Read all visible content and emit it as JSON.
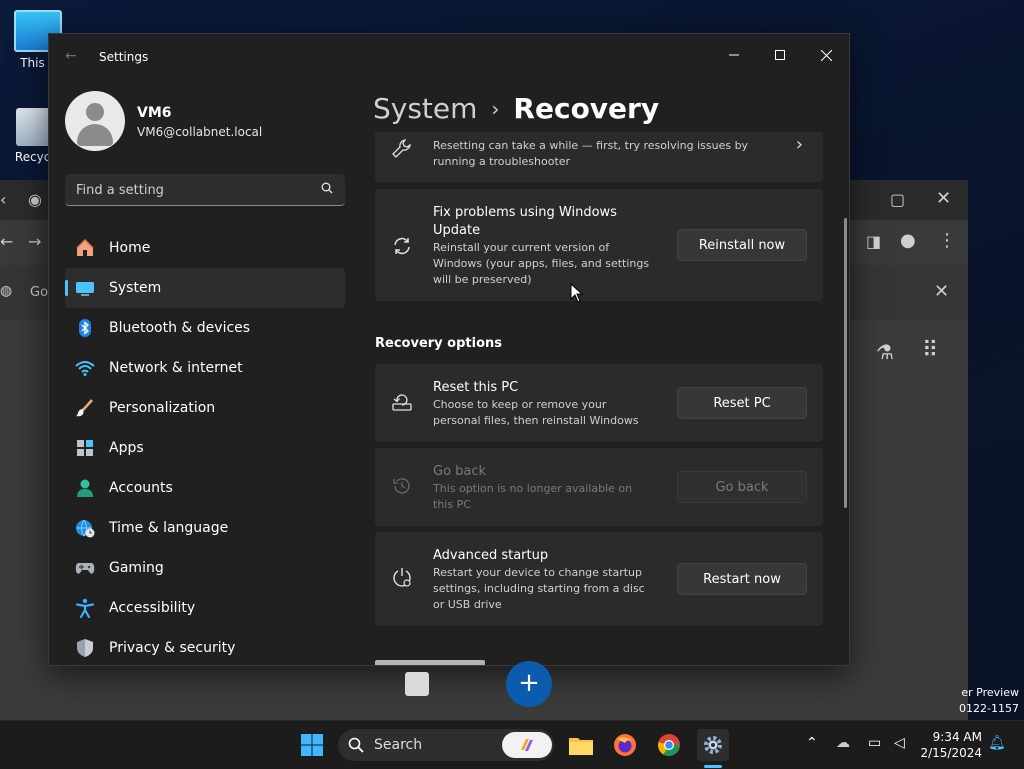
{
  "desktop": {
    "icons": [
      {
        "label": "This P"
      },
      {
        "label": "Recycle"
      }
    ],
    "bg_browser": {
      "omnibox_partial": "Go",
      "preview_line1": "er Preview",
      "preview_line2": "0122-1157"
    }
  },
  "settings": {
    "title": "Settings",
    "user": {
      "name": "VM6",
      "email": "VM6@collabnet.local"
    },
    "search": {
      "placeholder": "Find a setting"
    },
    "nav": [
      {
        "label": "Home",
        "icon": "home-icon"
      },
      {
        "label": "System",
        "icon": "system-icon",
        "active": true
      },
      {
        "label": "Bluetooth & devices",
        "icon": "bluetooth-icon"
      },
      {
        "label": "Network & internet",
        "icon": "wifi-icon"
      },
      {
        "label": "Personalization",
        "icon": "brush-icon"
      },
      {
        "label": "Apps",
        "icon": "apps-icon"
      },
      {
        "label": "Accounts",
        "icon": "accounts-icon"
      },
      {
        "label": "Time & language",
        "icon": "globe-clock-icon"
      },
      {
        "label": "Gaming",
        "icon": "gamepad-icon"
      },
      {
        "label": "Accessibility",
        "icon": "accessibility-icon"
      },
      {
        "label": "Privacy & security",
        "icon": "shield-icon"
      }
    ],
    "breadcrumb": {
      "parent": "System",
      "current": "Recovery"
    },
    "cards": {
      "troubleshoot": {
        "desc": "Resetting can take a while — first, try resolving issues by running a troubleshooter"
      },
      "fix_update": {
        "title": "Fix problems using Windows Update",
        "desc": "Reinstall your current version of Windows (your apps, files, and settings will be preserved)",
        "button": "Reinstall now"
      },
      "section_label": "Recovery options",
      "reset": {
        "title": "Reset this PC",
        "desc": "Choose to keep or remove your personal files, then reinstall Windows",
        "button": "Reset PC"
      },
      "go_back": {
        "title": "Go back",
        "desc": "This option is no longer available on this PC",
        "button": "Go back"
      },
      "advanced": {
        "title": "Advanced startup",
        "desc": "Restart your device to change startup settings, including starting from a disc or USB drive",
        "button": "Restart now"
      }
    }
  },
  "taskbar": {
    "search_label": "Search",
    "time": "9:34 AM",
    "date": "2/15/2024"
  },
  "colors": {
    "accent": "#4cc2ff",
    "window_bg": "#202020",
    "card_bg": "#2b2b2b"
  }
}
